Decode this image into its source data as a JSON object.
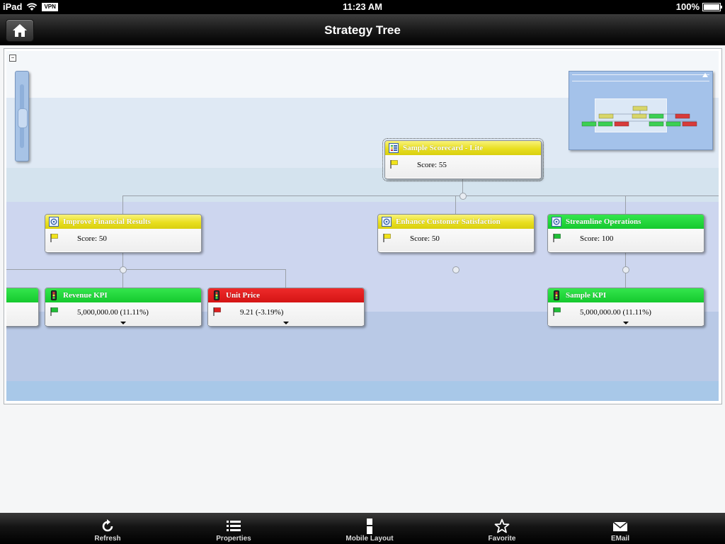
{
  "status_bar": {
    "device": "iPad",
    "vpn_label": "VPN",
    "time": "11:23 AM",
    "battery": "100%",
    "battery_level": 1.0
  },
  "nav": {
    "title": "Strategy Tree",
    "home_icon": "home-icon"
  },
  "tree": {
    "collapse_symbol": "−",
    "nodes": {
      "root": {
        "title": "Sample Scorecard - Lite",
        "value": "Score: 55",
        "status": "yellow",
        "icon": "scorecard-icon"
      },
      "financial": {
        "title": "Improve Financial Results",
        "value": "Score: 50",
        "status": "yellow",
        "icon": "objective-icon"
      },
      "customer": {
        "title": "Enhance Customer Satisfaction",
        "value": "Score: 50",
        "status": "yellow",
        "icon": "objective-icon"
      },
      "operations": {
        "title": "Streamline Operations",
        "value": "Score: 100",
        "status": "green",
        "icon": "objective-icon"
      },
      "partial": {
        "title": "",
        "value": "",
        "status": "green",
        "icon": "kpi-icon"
      },
      "revenue": {
        "title": "Revenue KPI",
        "value": "5,000,000.00 (11.11%)",
        "status": "green",
        "icon": "kpi-icon"
      },
      "unitprice": {
        "title": "Unit Price",
        "value": "9.21 (-3.19%)",
        "status": "red",
        "icon": "kpi-icon"
      },
      "sample": {
        "title": "Sample KPI",
        "value": "5,000,000.00 (11.11%)",
        "status": "green",
        "icon": "kpi-icon"
      }
    }
  },
  "toolbar": {
    "items": [
      {
        "label": "Refresh",
        "icon": "refresh-icon"
      },
      {
        "label": "Properties",
        "icon": "list-icon"
      },
      {
        "label": "Mobile Layout",
        "icon": "mobile-layout-icon"
      },
      {
        "label": "Favorite",
        "icon": "star-icon"
      },
      {
        "label": "EMail",
        "icon": "mail-icon"
      }
    ]
  },
  "colors": {
    "yellow": "#e9df1f",
    "green": "#15c92e",
    "red": "#d41414",
    "band_1": "#dfe9f4",
    "band_2": "#d4e3ee",
    "band_3": "#cdd6ef",
    "band_4": "#b9c9e6",
    "band_5": "#a8c8e8"
  }
}
